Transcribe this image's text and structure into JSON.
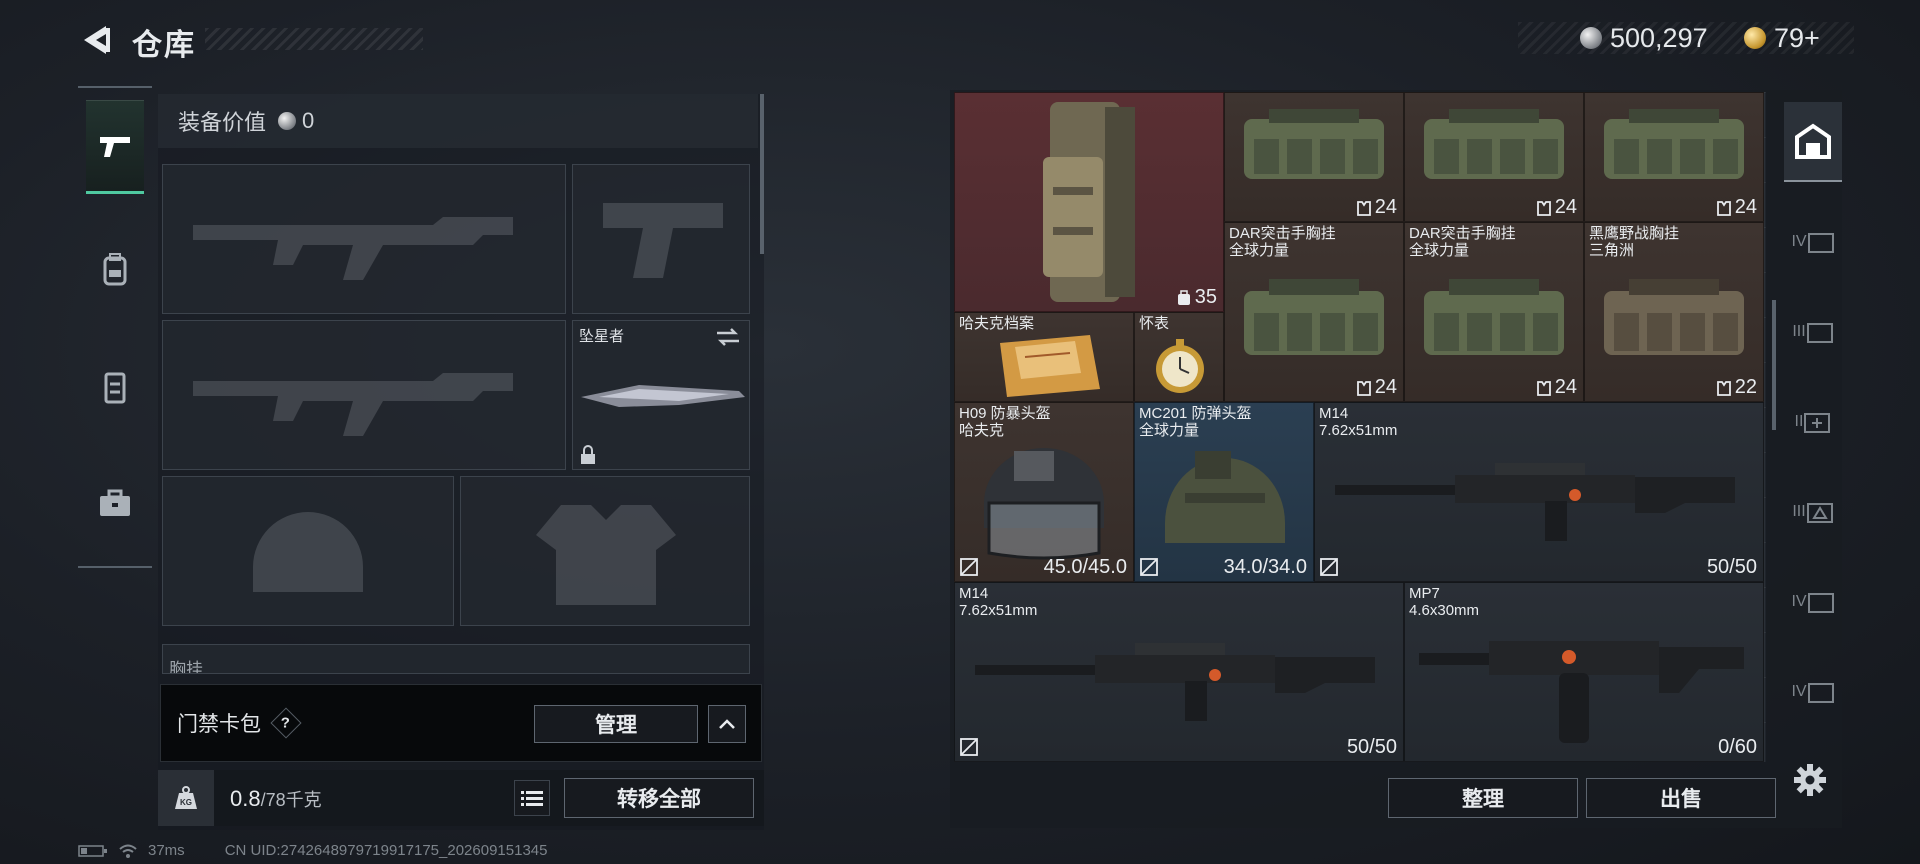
{
  "header": {
    "title": "仓库"
  },
  "currency": {
    "silver": "500,297",
    "gold": "79+"
  },
  "left": {
    "equip_value_label": "装备价值",
    "equip_value": "0",
    "melee_slot_name": "坠星者",
    "chest_label_partial": "胸挂"
  },
  "card_bar": {
    "label": "门禁卡包",
    "help": "?",
    "manage": "管理"
  },
  "weight": {
    "current": "0.8",
    "max": "/78千克",
    "transfer_all": "转移全部"
  },
  "items": [
    {
      "id": "backpack",
      "name": "",
      "count": "35"
    },
    {
      "id": "rig1",
      "name": "",
      "count": "24"
    },
    {
      "id": "rig2",
      "name": "",
      "count": "24"
    },
    {
      "id": "rig3",
      "name": "",
      "count": "24"
    },
    {
      "id": "rig4",
      "name": "DAR突击手胸挂\n全球力量",
      "count": "24"
    },
    {
      "id": "rig5",
      "name": "DAR突击手胸挂\n全球力量",
      "count": "24"
    },
    {
      "id": "rig6",
      "name": "黑鹰野战胸挂\n三角洲",
      "count": "22"
    },
    {
      "id": "docs",
      "name": "哈夫克档案",
      "count": ""
    },
    {
      "id": "watch",
      "name": "怀表",
      "count": ""
    },
    {
      "id": "helmet1",
      "name": "H09 防暴头盔\n哈夫克",
      "count": "45.0/45.0"
    },
    {
      "id": "helmet2",
      "name": "MC201 防弹头盔\n全球力量",
      "count": "34.0/34.0"
    },
    {
      "id": "m14a",
      "name": "M14\n7.62x51mm",
      "count": "50/50"
    },
    {
      "id": "m14b",
      "name": "M14\n7.62x51mm",
      "count": "50/50"
    },
    {
      "id": "mp7",
      "name": "MP7\n4.6x30mm",
      "count": "0/60"
    }
  ],
  "bottom_actions": {
    "sort": "整理",
    "sell": "出售"
  },
  "right_rail": {
    "tabs": [
      "IV",
      "III",
      "II",
      "III",
      "IV",
      "IV"
    ]
  },
  "status": {
    "ping": "37ms",
    "uid": "CN UID:2742648979719917175_202609151345"
  },
  "colors": {
    "accent": "#4fc9a0",
    "rare_red": "#5a2f33",
    "rare_blue": "#2b3f52"
  }
}
